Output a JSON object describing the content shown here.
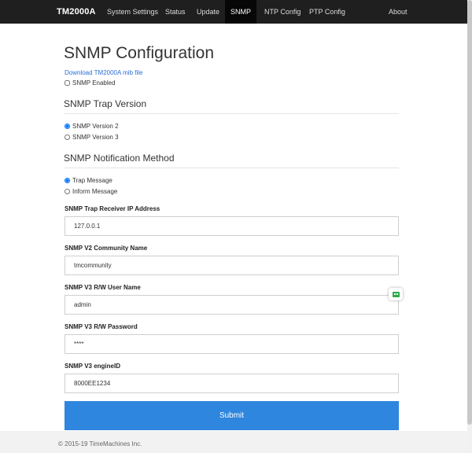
{
  "nav": {
    "brand": "TM2000A",
    "items": [
      {
        "label": "System Settings"
      },
      {
        "label": "Status"
      },
      {
        "label": "Update"
      },
      {
        "label": "SNMP"
      },
      {
        "label": "NTP Config"
      },
      {
        "label": "PTP Config"
      },
      {
        "label": "About"
      }
    ],
    "active": "SNMP"
  },
  "page": {
    "title": "SNMP Configuration",
    "mib_link": "Download TM2000A mib file",
    "snmp_enabled_label": "SNMP Enabled",
    "snmp_enabled": false
  },
  "trap_version": {
    "heading": "SNMP Trap Version",
    "options": [
      "SNMP Version 2",
      "SNMP Version 3"
    ],
    "selected": "SNMP Version 2"
  },
  "notification": {
    "heading": "SNMP Notification Method",
    "options": [
      "Trap Message",
      "Inform Message"
    ],
    "selected": "Trap Message"
  },
  "fields": {
    "receiver_ip": {
      "label": "SNMP Trap Receiver IP Address",
      "value": "127.0.0.1"
    },
    "community": {
      "label": "SNMP V2 Community Name",
      "value": "tmcommunity"
    },
    "v3_user": {
      "label": "SNMP V3 R/W User Name",
      "value": "admin"
    },
    "v3_password": {
      "label": "SNMP V3 R/W Password",
      "value": "****"
    },
    "engine_id": {
      "label": "SNMP V3 engineID",
      "value": "8000EE1234"
    }
  },
  "submit_label": "Submit",
  "footer": {
    "copyright": "© 2015-19 TimeMachines Inc."
  },
  "colors": {
    "navbar": "#1f1f1f",
    "accent": "#2e86de",
    "link": "#2a6fd6",
    "widget": "#2eaa4a"
  },
  "icons": {
    "widget": "bot-face-icon"
  }
}
